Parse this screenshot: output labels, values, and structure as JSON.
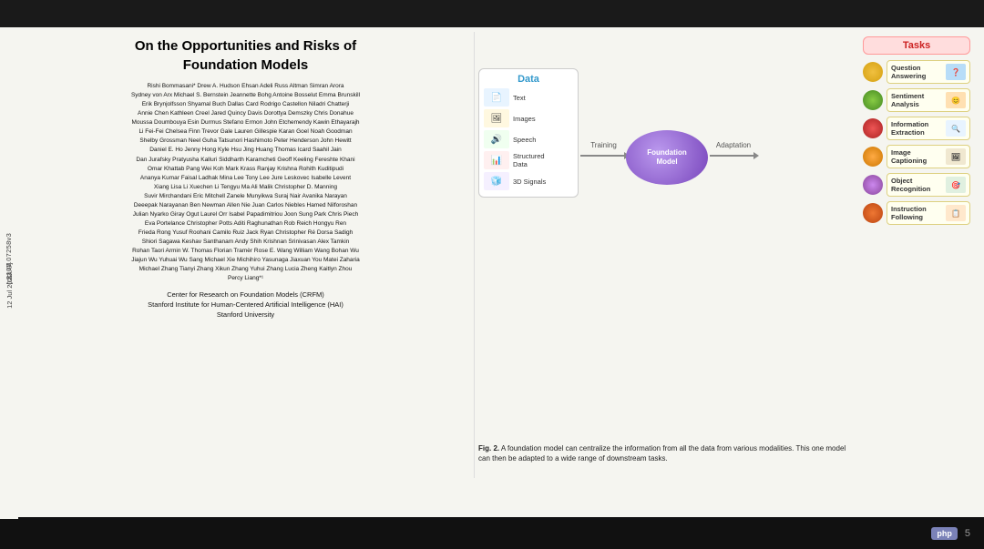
{
  "paper": {
    "title_line1": "On the Opportunities and Risks of",
    "title_line2": "Foundation Models",
    "authors": "Rishi Bommasani*  Drew A. Hudson  Ehsan Adeli  Russ Altman  Simran Arora\nSydney von Arx  Michael S. Bernstein  Jeannette Bohg  Antoine Bosselut  Emma Brunskill\nErik Brynjolfsson  Shyamal Buch  Dallas Card  Rodrigo Castellon  Niladri Chatterji\nAnnie Chen  Kathleen Creel  Jared Quincy Davis  Dorottya Demszky  Chris Donahue\nMoussa Doumbouya  Esin Durmus  Stefano Ermon  John Etchemendy  Kawin Ethayarajh\nLi Fei-Fei  Chelsea Finn  Trevor Gale  Lauren Gillespie  Karan Goel  Noah Goodman\nShelby Grossman  Neel Guha  Tatsunori Hashimoto  Peter Henderson  John Hewitt\nDaniel E. Ho  Jenny Hong  Kyle Hsu  Jing Huang  Thomas Icard  Saahil Jain\nDan Jurafsky  Pratyusha Kalluri  Siddharth Karamcheti  Geoff Keeling  Fereshte Khani\nOmar Khattab  Pang Wei Koh  Mark Krass  Ranjay Krishna  Rohith Kuditipudi\nAnanya Kumar  Faisal Ladhak  Mina Lee  Tony Lee  Jure Leskovec  Isabelle Levent\nXiang Lisa Li  Xuechen Li  Tengyu Ma  Ali Malik  Christopher D. Manning\nSuvir Mirchandani  Eric Mitchell  Zanele Munyikwa  Suraj Nair  Avanika Narayan\nDeeepak Narayanan  Ben Newman  Allen Nie  Juan Carlos Niebles  Hamed Nilforoshan\nJulian Nyarko  Giray Ogut  Laurel Orr  Isabel Papadimitriou  Joon Sung Park  Chris Piech\nEva Portelance  Christopher Potts  Aditi Raghunathan  Rob Reich  Hongyu Ren\nFrieda Rong  Yusuf Roohani  Camilo Ruiz  Jack Ryan  Christopher Ré  Dorsa Sadigh\nShiori Sagawa  Keshav Santhanam  Andy Shih  Krishnan Srinivasan  Alex Tamkin\nRohan Taori  Armin W. Thomas  Florian Tramèr  Rose E. Wang  William Wang  Bohan Wu\nJiajun Wu  Yuhuai Wu  Sang Michael Xie  Michihiro Yasunaga  Jiaxuan You  Matei Zaharia\nMichael Zhang  Tianyi Zhang  Xikun Zhang  Yuhui Zhang  Lucia Zheng  Kaitlyn Zhou\nPercy Liang*¹",
    "affiliation1": "Center for Research on Foundation Models (CRFM)",
    "affiliation2": "Stanford Institute for Human-Centered Artificial Intelligence (HAI)",
    "affiliation3": "Stanford University"
  },
  "diagram": {
    "data_label": "Data",
    "data_items": [
      {
        "label": "Text",
        "icon": "📄"
      },
      {
        "label": "Images",
        "icon": "🖼"
      },
      {
        "label": "Speech",
        "icon": "🔊"
      },
      {
        "label": "Structured Data",
        "icon": "📊"
      },
      {
        "label": "3D Signals",
        "icon": "🧊"
      }
    ],
    "training_label": "Training",
    "foundation_label": "Foundation\nModel",
    "adaptation_label": "Adaptation",
    "tasks_header": "Tasks",
    "tasks": [
      {
        "label": "Question\nAnswering",
        "color": "#e6a020"
      },
      {
        "label": "Sentiment\nAnalysis",
        "color": "#44aa44"
      },
      {
        "label": "Information\nExtraction",
        "color": "#cc4444"
      },
      {
        "label": "Image\nCaptioning",
        "color": "#dd8833"
      },
      {
        "label": "Object\nRecognition",
        "color": "#aa44aa"
      },
      {
        "label": "Instruction\nFollowing",
        "color": "#dd6633"
      }
    ]
  },
  "caption": {
    "fig_label": "Fig. 2.",
    "text": "A foundation model can centralize the information from all the data from various modalities. This one model can then be adapted to a wide range of downstream tasks."
  },
  "side_date": "12 Jul 2022",
  "side_arxiv": "[cs.LG]",
  "side_arxiv2": "2108.07258v3",
  "bottom": {
    "php_label": "php",
    "page_number": "5"
  }
}
